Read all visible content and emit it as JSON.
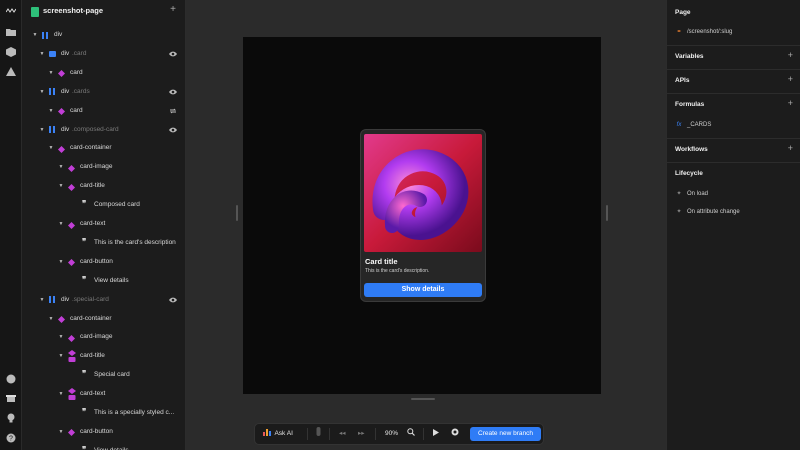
{
  "page_title": "screenshot-page",
  "layers": [
    {
      "label": "div",
      "sub": "",
      "icon": "div",
      "depth": 0,
      "chev": "down",
      "eye": false
    },
    {
      "label": "div",
      "sub": ".card",
      "icon": "div2",
      "depth": 1,
      "chev": "down",
      "eye": true
    },
    {
      "label": "card",
      "sub": "",
      "icon": "comp",
      "depth": 2,
      "chev": "down",
      "eye": false
    },
    {
      "label": "div",
      "sub": ".cards",
      "icon": "div",
      "depth": 1,
      "chev": "down",
      "eye": true
    },
    {
      "label": "card",
      "sub": "",
      "icon": "comp",
      "depth": 2,
      "chev": "down",
      "eye": false,
      "repeat": true
    },
    {
      "label": "div",
      "sub": ".composed-card",
      "icon": "div",
      "depth": 1,
      "chev": "down",
      "eye": true
    },
    {
      "label": "card-container",
      "sub": "",
      "icon": "comp",
      "depth": 2,
      "chev": "down",
      "eye": false
    },
    {
      "label": "card-image",
      "sub": "",
      "icon": "comp",
      "depth": 3,
      "chev": "down",
      "eye": false
    },
    {
      "label": "card-title",
      "sub": "",
      "icon": "comp",
      "depth": 3,
      "chev": "down",
      "eye": false
    },
    {
      "label": "Composed card",
      "sub": "",
      "icon": "quote",
      "depth": 4,
      "chev": "",
      "eye": false
    },
    {
      "label": "card-text",
      "sub": "",
      "icon": "comp",
      "depth": 3,
      "chev": "down",
      "eye": false
    },
    {
      "label": "This is the card's description",
      "sub": "",
      "icon": "quote",
      "depth": 4,
      "chev": "",
      "eye": false
    },
    {
      "label": "card-button",
      "sub": "",
      "icon": "comp",
      "depth": 3,
      "chev": "down",
      "eye": false
    },
    {
      "label": "View details",
      "sub": "",
      "icon": "quote",
      "depth": 4,
      "chev": "",
      "eye": false
    },
    {
      "label": "div",
      "sub": ".special-card",
      "icon": "div",
      "depth": 1,
      "chev": "down",
      "eye": true
    },
    {
      "label": "card-container",
      "sub": "",
      "icon": "comp",
      "depth": 2,
      "chev": "down",
      "eye": false
    },
    {
      "label": "card-image",
      "sub": "",
      "icon": "comp",
      "depth": 3,
      "chev": "down",
      "eye": false
    },
    {
      "label": "card-title",
      "sub": "",
      "icon": "comptag",
      "depth": 3,
      "chev": "down",
      "eye": false
    },
    {
      "label": "Special card",
      "sub": "",
      "icon": "quote",
      "depth": 4,
      "chev": "",
      "eye": false
    },
    {
      "label": "card-text",
      "sub": "",
      "icon": "comptag",
      "depth": 3,
      "chev": "down",
      "eye": false
    },
    {
      "label": "This is a specially styled c...",
      "sub": "",
      "icon": "quote",
      "depth": 4,
      "chev": "",
      "eye": false
    },
    {
      "label": "card-button",
      "sub": "",
      "icon": "comp",
      "depth": 3,
      "chev": "down",
      "eye": false
    },
    {
      "label": "View details",
      "sub": "",
      "icon": "quote",
      "depth": 4,
      "chev": "",
      "eye": false
    }
  ],
  "preview_card": {
    "title": "Card title",
    "text": "This is the card's description.",
    "button": "Show details"
  },
  "toolbar": {
    "ask_ai": "Ask AI",
    "zoom": "90%",
    "create_branch": "Create new branch"
  },
  "props": {
    "page_label": "Page",
    "page_slug": "/screenshot/:slug",
    "variables": "Variables",
    "apis": "APIs",
    "formulas": "Formulas",
    "formula_item": "_CARDS",
    "workflows": "Workflows",
    "lifecycle": "Lifecycle",
    "on_load": "On load",
    "on_attr": "On attribute change"
  },
  "colors": {
    "accent": "#2f7cf6",
    "component": "#c13ed6",
    "div": "#3b82f6",
    "formula": "#3b82f6",
    "page_link": "#e07a2e"
  }
}
